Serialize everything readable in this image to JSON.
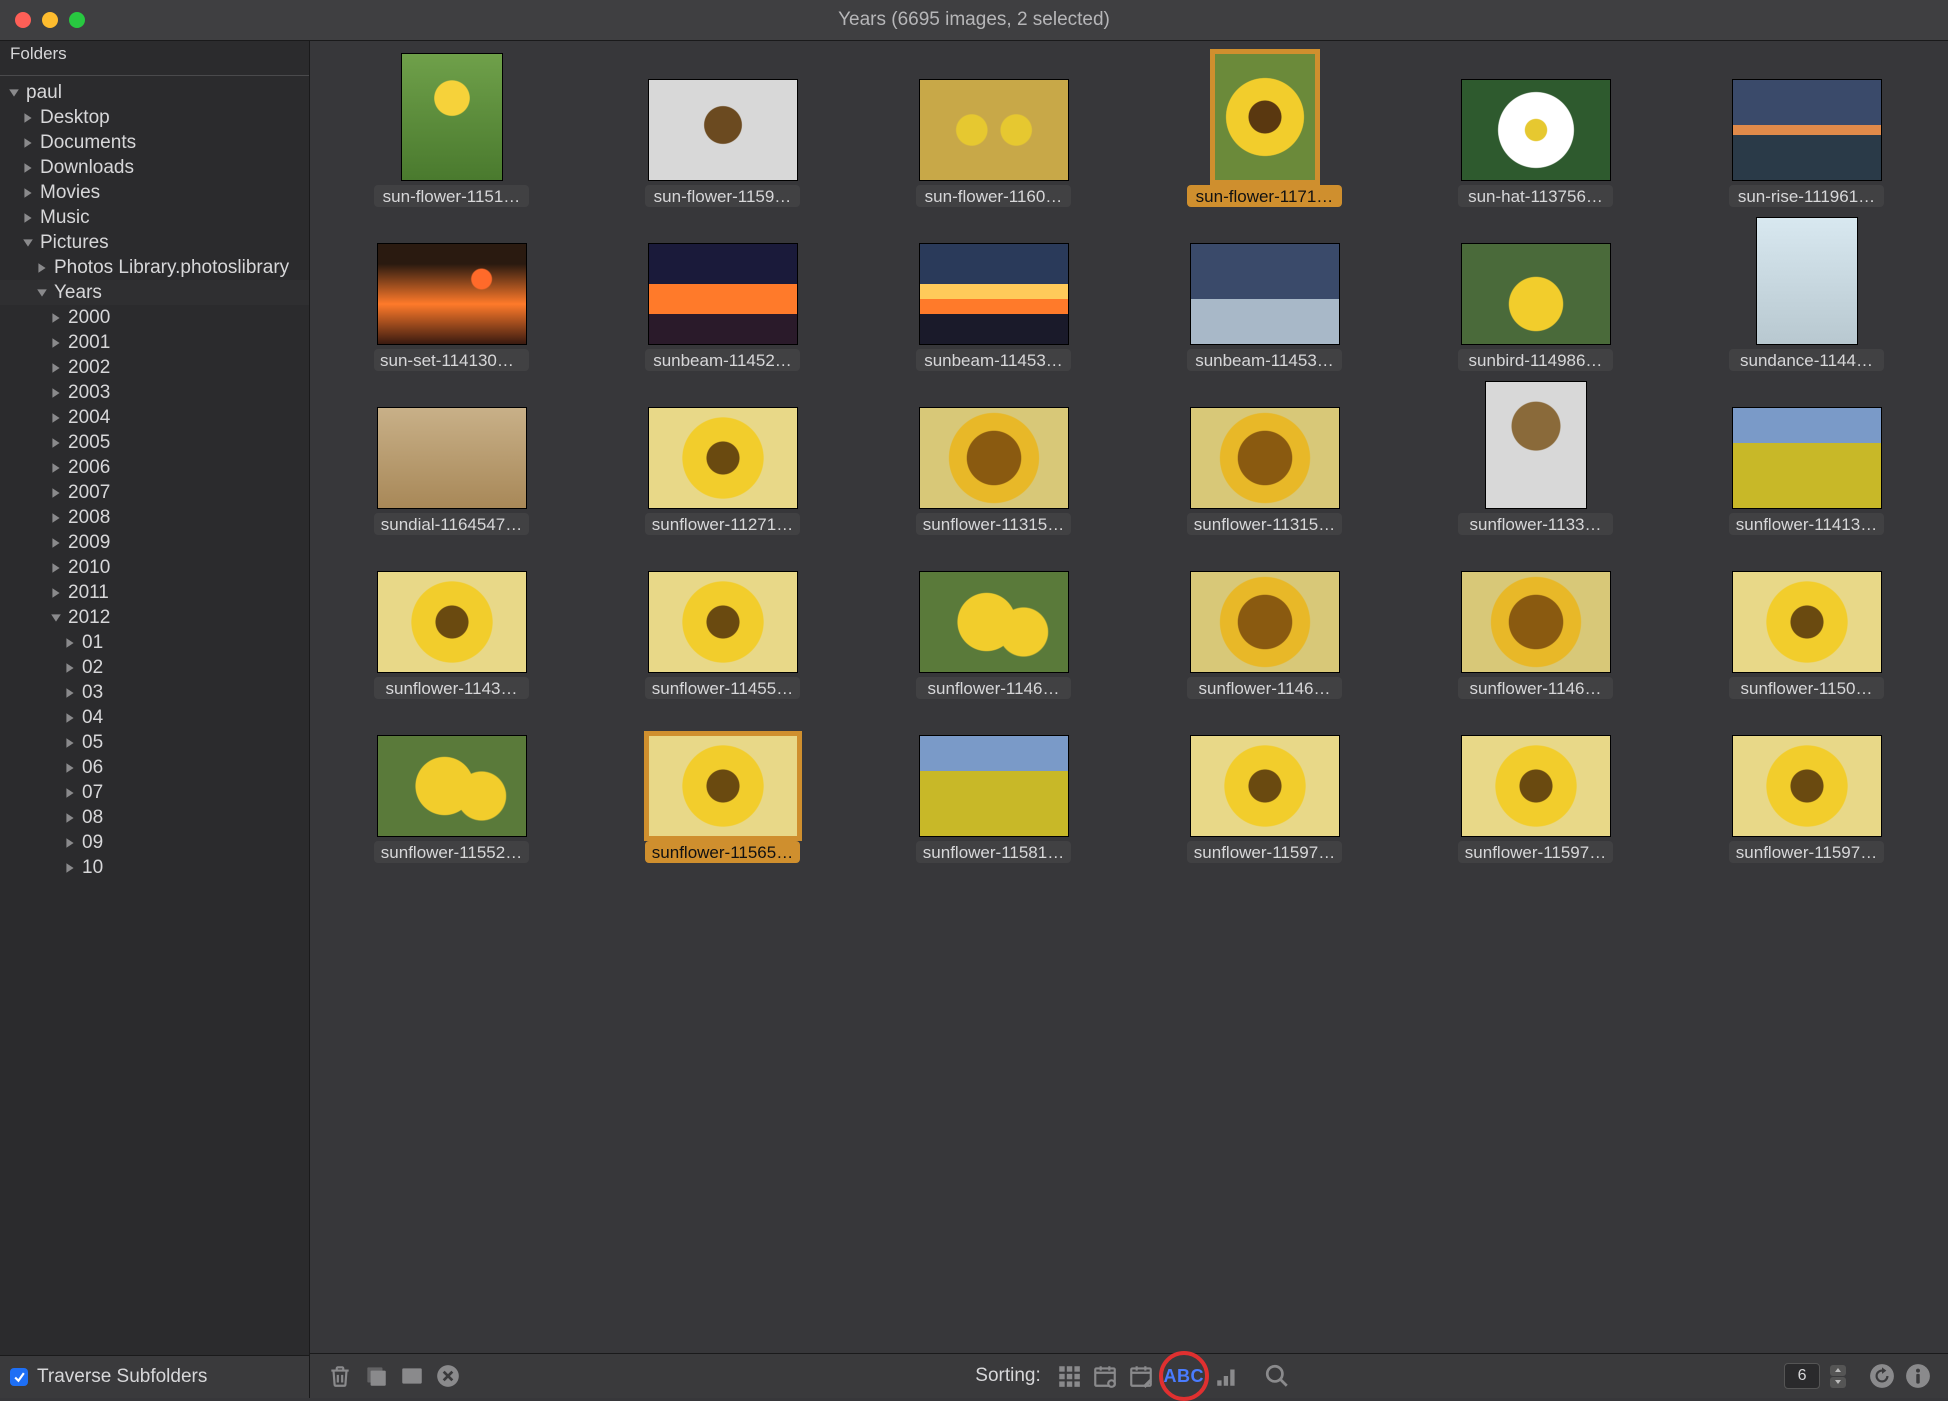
{
  "window": {
    "title": "Years (6695 images, 2 selected)"
  },
  "sidebar": {
    "header": "Folders",
    "traverse_label": "Traverse Subfolders",
    "traverse_checked": true,
    "tree": [
      {
        "label": "paul",
        "depth": 0,
        "expanded": true
      },
      {
        "label": "Desktop",
        "depth": 1,
        "expanded": false
      },
      {
        "label": "Documents",
        "depth": 1,
        "expanded": false
      },
      {
        "label": "Downloads",
        "depth": 1,
        "expanded": false
      },
      {
        "label": "Movies",
        "depth": 1,
        "expanded": false
      },
      {
        "label": "Music",
        "depth": 1,
        "expanded": false
      },
      {
        "label": "Pictures",
        "depth": 1,
        "expanded": true
      },
      {
        "label": "Photos Library.photoslibrary",
        "depth": 2,
        "expanded": false
      },
      {
        "label": "Years",
        "depth": 2,
        "expanded": true,
        "selected": true
      },
      {
        "label": "2000",
        "depth": 3,
        "expanded": false
      },
      {
        "label": "2001",
        "depth": 3,
        "expanded": false
      },
      {
        "label": "2002",
        "depth": 3,
        "expanded": false
      },
      {
        "label": "2003",
        "depth": 3,
        "expanded": false
      },
      {
        "label": "2004",
        "depth": 3,
        "expanded": false
      },
      {
        "label": "2005",
        "depth": 3,
        "expanded": false
      },
      {
        "label": "2006",
        "depth": 3,
        "expanded": false
      },
      {
        "label": "2007",
        "depth": 3,
        "expanded": false
      },
      {
        "label": "2008",
        "depth": 3,
        "expanded": false
      },
      {
        "label": "2009",
        "depth": 3,
        "expanded": false
      },
      {
        "label": "2010",
        "depth": 3,
        "expanded": false
      },
      {
        "label": "2011",
        "depth": 3,
        "expanded": false
      },
      {
        "label": "2012",
        "depth": 3,
        "expanded": true
      },
      {
        "label": "01",
        "depth": 4,
        "expanded": false
      },
      {
        "label": "02",
        "depth": 4,
        "expanded": false
      },
      {
        "label": "03",
        "depth": 4,
        "expanded": false
      },
      {
        "label": "04",
        "depth": 4,
        "expanded": false
      },
      {
        "label": "05",
        "depth": 4,
        "expanded": false
      },
      {
        "label": "06",
        "depth": 4,
        "expanded": false
      },
      {
        "label": "07",
        "depth": 4,
        "expanded": false
      },
      {
        "label": "08",
        "depth": 4,
        "expanded": false
      },
      {
        "label": "09",
        "depth": 4,
        "expanded": false
      },
      {
        "label": "10",
        "depth": 4,
        "expanded": false
      }
    ]
  },
  "grid": {
    "items": [
      {
        "label": "sun-flower-1151…",
        "art": "t-sun1",
        "tall": true
      },
      {
        "label": "sun-flower-1159…",
        "art": "t-sun2"
      },
      {
        "label": "sun-flower-1160…",
        "art": "t-sun3"
      },
      {
        "label": "sun-flower-1171…",
        "art": "t-sun4",
        "selected": true,
        "tall": true
      },
      {
        "label": "sun-hat-113756…",
        "art": "t-daisy"
      },
      {
        "label": "sun-rise-111961…",
        "art": "t-rise"
      },
      {
        "label": "sun-set-1141301…",
        "art": "t-set"
      },
      {
        "label": "sunbeam-11452…",
        "art": "t-beam1"
      },
      {
        "label": "sunbeam-11453…",
        "art": "t-beam2"
      },
      {
        "label": "sunbeam-11453…",
        "art": "t-beam3"
      },
      {
        "label": "sunbird-114986…",
        "art": "t-bird"
      },
      {
        "label": "sundance-1144…",
        "art": "t-snow",
        "tall": true
      },
      {
        "label": "sundial-1164547…",
        "art": "t-dial"
      },
      {
        "label": "sunflower-11271…",
        "art": "t-sf"
      },
      {
        "label": "sunflower-11315…",
        "art": "t-sf2"
      },
      {
        "label": "sunflower-11315…",
        "art": "t-sf2"
      },
      {
        "label": "sunflower-1133…",
        "art": "t-dead",
        "tall": true
      },
      {
        "label": "sunflower-11413…",
        "art": "t-field"
      },
      {
        "label": "sunflower-1143…",
        "art": "t-sf"
      },
      {
        "label": "sunflower-11455…",
        "art": "t-sf"
      },
      {
        "label": "sunflower-1146…",
        "art": "t-sf3"
      },
      {
        "label": "sunflower-1146…",
        "art": "t-sf2"
      },
      {
        "label": "sunflower-1146…",
        "art": "t-sf2"
      },
      {
        "label": "sunflower-1150…",
        "art": "t-sf"
      },
      {
        "label": "sunflower-11552…",
        "art": "t-sf3"
      },
      {
        "label": "sunflower-11565…",
        "art": "t-sf",
        "selected": true
      },
      {
        "label": "sunflower-11581…",
        "art": "t-field"
      },
      {
        "label": "sunflower-11597…",
        "art": "t-sf"
      },
      {
        "label": "sunflower-11597…",
        "art": "t-sf"
      },
      {
        "label": "sunflower-11597…",
        "art": "t-sf"
      }
    ]
  },
  "toolbar": {
    "sorting_label": "Sorting:",
    "abc_label": "ABC",
    "columns_value": "6"
  }
}
